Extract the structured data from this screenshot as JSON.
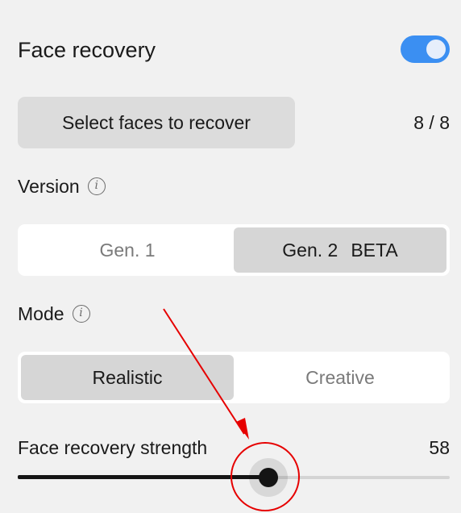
{
  "panel": {
    "title": "Face recovery",
    "enabled": true,
    "select_button_label": "Select faces to recover",
    "face_count": "8 / 8"
  },
  "version": {
    "label": "Version",
    "info_glyph": "i",
    "options": [
      {
        "label": "Gen. 1",
        "badge": "",
        "selected": false
      },
      {
        "label": "Gen. 2",
        "badge": "BETA",
        "selected": true
      }
    ]
  },
  "mode": {
    "label": "Mode",
    "info_glyph": "i",
    "options": [
      {
        "label": "Realistic",
        "selected": true
      },
      {
        "label": "Creative",
        "selected": false
      }
    ]
  },
  "strength": {
    "label": "Face recovery strength",
    "value": "58",
    "level": 0.58
  },
  "colors": {
    "accent": "#3b8ff2",
    "annotation": "#e60000"
  },
  "icons": [
    "info-icon",
    "toggle-switch",
    "slider-thumb"
  ]
}
